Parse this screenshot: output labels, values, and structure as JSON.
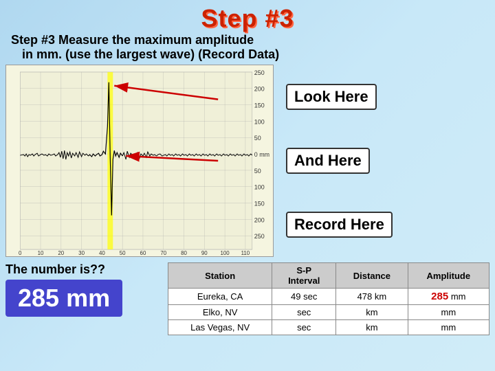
{
  "title": "Step #3",
  "subtitle_line1": "Step #3   Measure the maximum amplitude",
  "subtitle_line2": "in mm. (use the largest wave) (Record Data)",
  "annotations": {
    "look_here": "Look Here",
    "and_here": "And Here",
    "record_here": "Record Here"
  },
  "bottom": {
    "number_label": "The number is??",
    "answer": "285 mm"
  },
  "table": {
    "headers": [
      "Station",
      "S-P\nInterval",
      "Distance",
      "Amplitude"
    ],
    "rows": [
      {
        "station": "Eureka, CA",
        "sp_interval": "49  sec",
        "distance": "478 km",
        "amplitude": "285",
        "amplitude_unit": "mm",
        "highlight": true
      },
      {
        "station": "Elko, NV",
        "sp_interval": "sec",
        "distance": "km",
        "amplitude": "",
        "amplitude_unit": "mm",
        "highlight": false
      },
      {
        "station": "Las Vegas, NV",
        "sp_interval": "sec",
        "distance": "km",
        "amplitude": "",
        "amplitude_unit": "mm",
        "highlight": false
      }
    ]
  },
  "chart": {
    "y_labels_right": [
      250,
      200,
      150,
      100,
      50,
      "0 mm",
      50,
      100,
      150,
      200,
      250
    ],
    "x_labels": [
      0,
      10,
      20,
      30,
      40,
      50,
      60,
      70,
      80,
      90,
      100,
      110
    ]
  }
}
